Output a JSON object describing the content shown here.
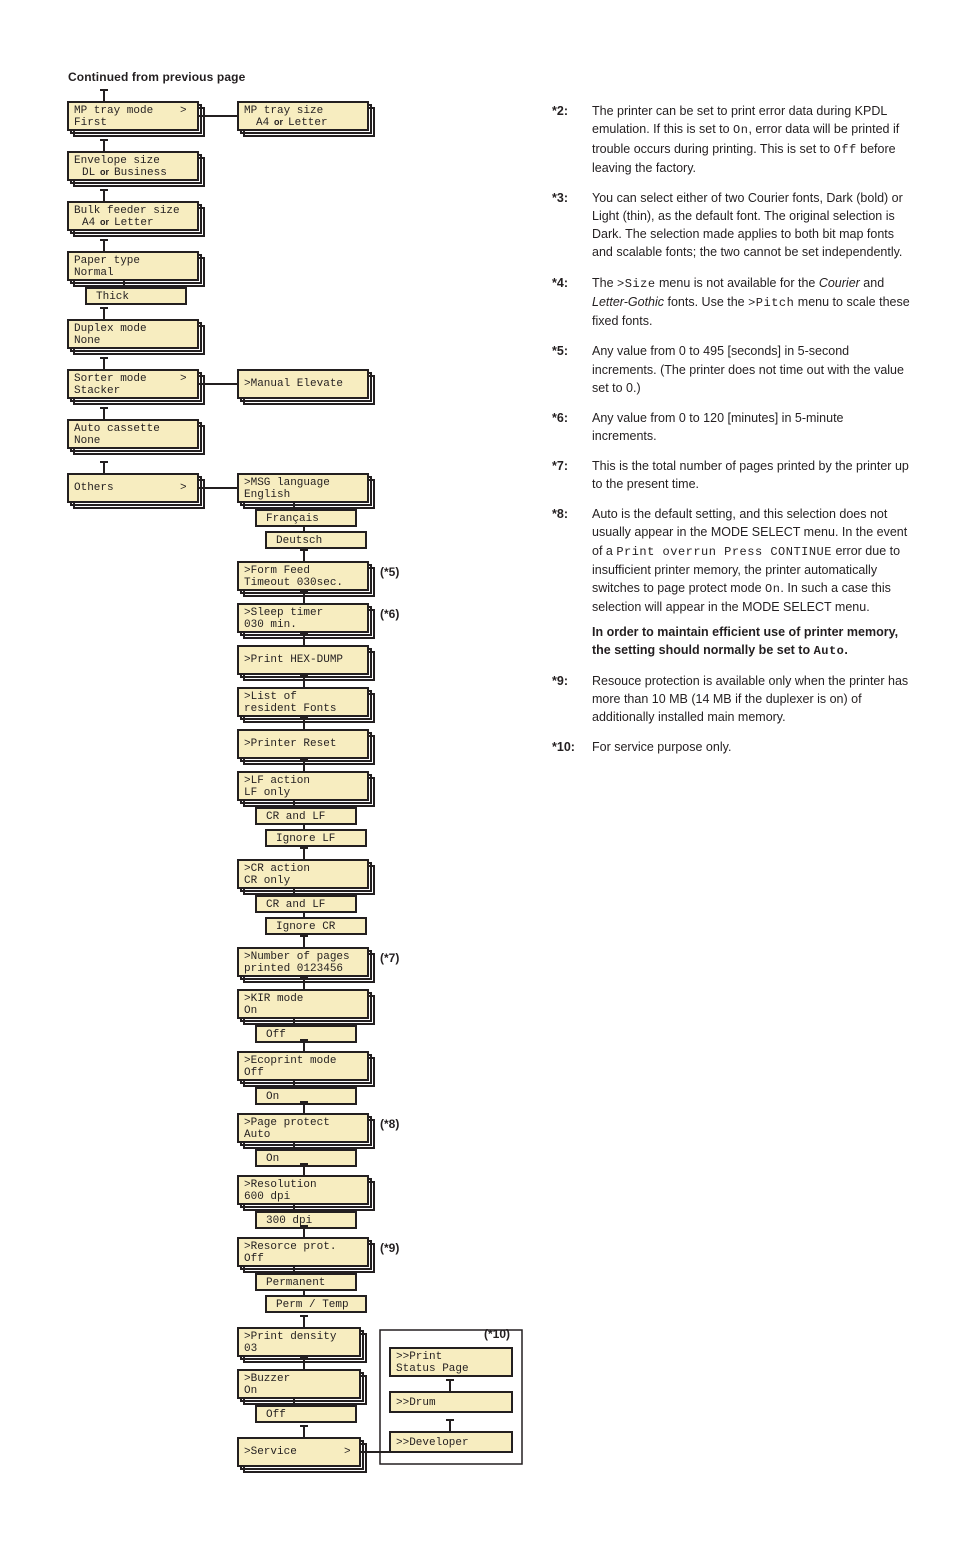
{
  "header": {
    "continued": "Continued from previous page"
  },
  "left_column": {
    "mp_tray_mode": {
      "line1": "MP tray mode",
      "line2": "First",
      "arrow": ">"
    },
    "mp_tray_size": {
      "line1": "MP tray size",
      "left": "A4",
      "or": "or",
      "right": "Letter"
    },
    "envelope": {
      "line1": "Envelope size",
      "left": "DL",
      "or": "or",
      "right": "Business"
    },
    "bulk": {
      "line1": "Bulk feeder size",
      "left": "A4",
      "or": "or",
      "right": "Letter"
    },
    "paper_type": {
      "line1": "Paper type",
      "line2": "Normal",
      "sub": "Thick"
    },
    "duplex": {
      "line1": "Duplex mode",
      "line2": "None"
    },
    "sorter": {
      "line1": "Sorter mode",
      "line2": "Stacker",
      "arrow": ">",
      "manual": ">Manual Elevate"
    },
    "auto_cassette": {
      "line1": "Auto cassette",
      "line2": "None"
    },
    "others": {
      "line1": "Others",
      "arrow": ">"
    }
  },
  "others_chain": {
    "msg_lang": {
      "line1": ">MSG language",
      "line2": "English",
      "subs": [
        "Français",
        "Deutsch"
      ]
    },
    "form_feed": {
      "line1": ">Form Feed",
      "line2": "Timeout 030sec.",
      "ref": "(*5)"
    },
    "sleep": {
      "line1": ">Sleep timer",
      "line2": "       030 min.",
      "ref": "(*6)"
    },
    "hexdump": {
      "line1": ">Print HEX-DUMP"
    },
    "listfonts": {
      "line1": ">List of",
      "line2": " resident Fonts"
    },
    "reset": {
      "line1": ">Printer Reset"
    },
    "lf": {
      "line1": ">LF action",
      "line2": " LF only",
      "subs": [
        "CR and LF",
        "Ignore LF"
      ]
    },
    "cr": {
      "line1": ">CR action",
      "line2": " CR only",
      "subs": [
        "CR and LF",
        "Ignore CR"
      ]
    },
    "pages": {
      "line1": ">Number of pages",
      "line2": "printed 0123456",
      "ref": "(*7)"
    },
    "kir": {
      "line1": ">KIR mode",
      "line2": " On",
      "subs": [
        "Off"
      ]
    },
    "eco": {
      "line1": ">Ecoprint mode",
      "line2": " Off",
      "subs": [
        "On"
      ]
    },
    "pageprot": {
      "line1": ">Page protect",
      "line2": " Auto",
      "subs": [
        "On"
      ],
      "ref": "(*8)"
    },
    "resolution": {
      "line1": ">Resolution",
      "line2": " 600 dpi",
      "subs": [
        "300 dpi"
      ]
    },
    "resource": {
      "line1": ">Resorce prot.",
      "line2": " Off",
      "subs": [
        "Permanent",
        "Perm / Temp"
      ],
      "ref": "(*9)"
    },
    "density": {
      "line1": ">Print density",
      "line2": " 03"
    },
    "buzzer": {
      "line1": ">Buzzer",
      "line2": " On",
      "subs": [
        "Off"
      ]
    },
    "service": {
      "line1": ">Service",
      "arrow": ">"
    }
  },
  "service_chain": {
    "ref": "(*10)",
    "status": {
      "line1": ">>Print",
      "line2": " Status Page"
    },
    "drum": {
      "line1": ">>Drum"
    },
    "dev": {
      "line1": ">>Developer"
    }
  },
  "notes": {
    "n2": {
      "label": "*2:",
      "p1a": "The printer can be set to print error data during KPDL emulation. If this is set to ",
      "inl1": "On",
      "p1b": ", error data will be printed if trouble occurs during printing. This is set to ",
      "inl2": "Off",
      "p1c": " before leaving the factory."
    },
    "n3": {
      "label": "*3:",
      "p1": "You can select either of two Courier fonts, Dark (bold) or Light (thin), as the default font. The original selection is Dark. The selection made applies to both bit map fonts and scalable fonts; the two cannot be set independently."
    },
    "n4": {
      "label": "*4:",
      "p1a": "The ",
      "inl1": ">Size",
      "p1b": " menu is not available for the ",
      "em1": "Courier",
      "p1c": " and ",
      "em2": "Letter-Gothic",
      "p1d": " fonts. Use the ",
      "inl2": ">Pitch",
      "p1e": " menu to scale these fixed fonts."
    },
    "n5": {
      "label": "*5:",
      "p1": "Any value from 0 to 495 [seconds] in 5-second increments. (The printer does not time out with the value set to 0.)"
    },
    "n6": {
      "label": "*6:",
      "p1": "Any value from 0 to 120 [minutes] in 5-minute increments."
    },
    "n7": {
      "label": "*7:",
      "p1": "This is the total number of pages printed by the printer up to the present time."
    },
    "n8": {
      "label": "*8:",
      "p1a": "Auto is the default setting, and this selection does not usually appear in the MODE SELECT menu. In the event of a ",
      "inl1": "Print overrun Press CONTINUE",
      "p1b": " error due to insufficient printer memory, the printer automatically switches to page protect mode ",
      "inl2": "On",
      "p1c": ". In such a case this selection will appear in the MODE SELECT menu.",
      "boldA": "In order to maintain efficient use of printer memory, the setting should normally be set to ",
      "boldB": "Auto",
      "boldC": "."
    },
    "n9": {
      "label": "*9:",
      "p1": "Resouce protection is available only when the printer has more than 10 MB (14 MB if the duplexer is on) of additionally installed main memory."
    },
    "n10": {
      "label": "*10:",
      "p1": "For service purpose only."
    }
  }
}
